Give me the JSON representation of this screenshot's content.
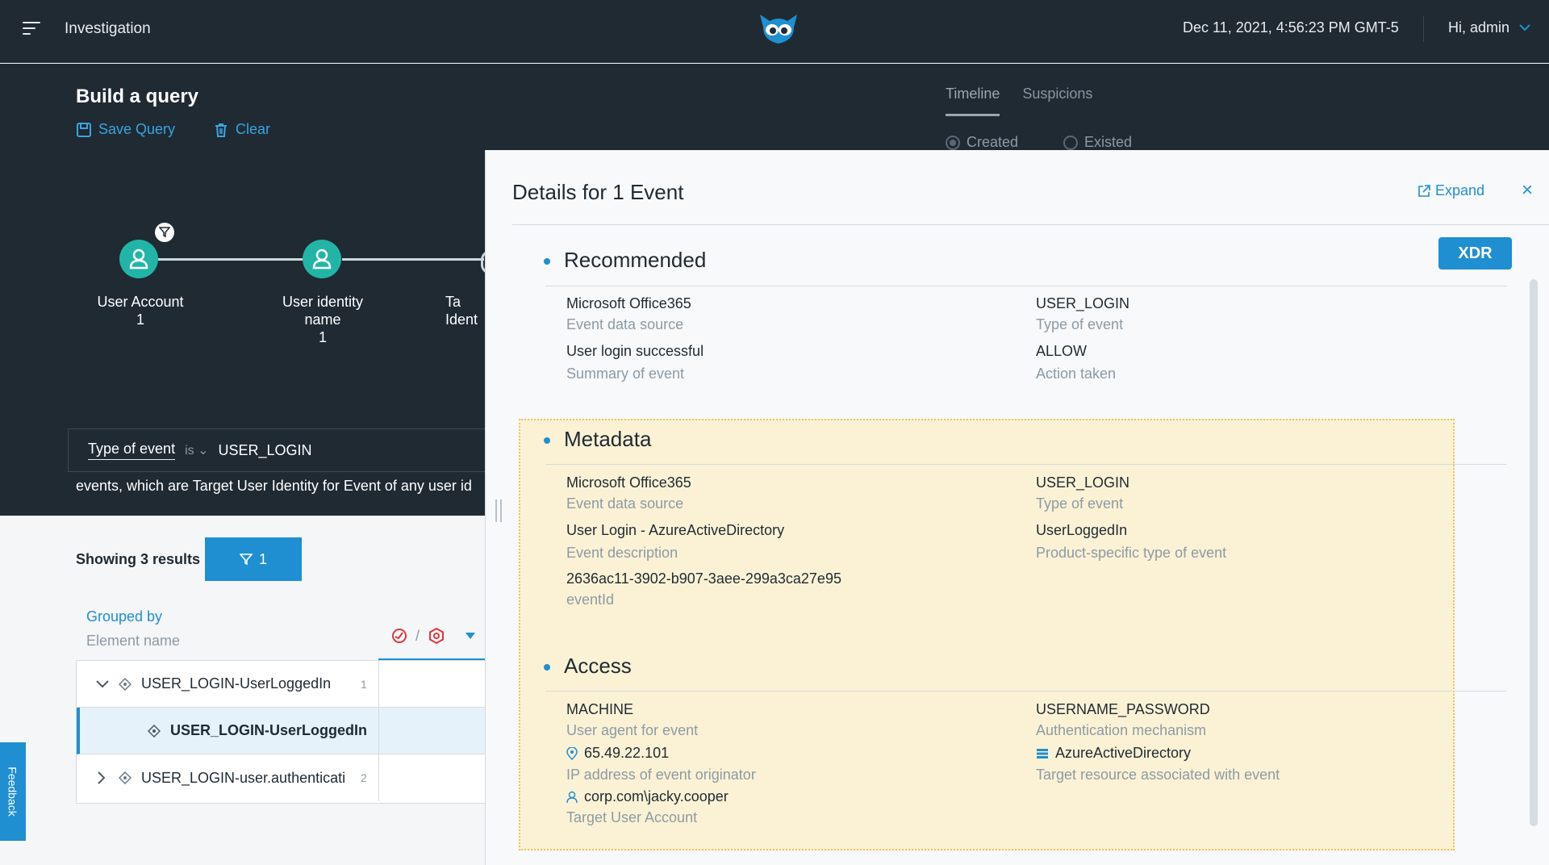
{
  "topbar": {
    "title": "Investigation",
    "datetime": "Dec 11, 2021, 4:56:23 PM GMT-5",
    "user_greeting": "Hi, admin"
  },
  "query": {
    "title": "Build a query",
    "save_label": "Save Query",
    "clear_label": "Clear",
    "tabs": [
      "Timeline",
      "Suspicions"
    ],
    "radios": [
      "Created",
      "Existed"
    ],
    "nodes": [
      {
        "label": "User Account",
        "count": "1"
      },
      {
        "label": "User identity name",
        "count": "1"
      },
      {
        "label": "Ta Ident",
        "count": ""
      }
    ],
    "filter": {
      "key": "Type of event",
      "op": "is",
      "value": "USER_LOGIN"
    },
    "description": "events, which are Target User Identity for Event of any user id"
  },
  "results": {
    "showing": "Showing 3 results",
    "filter_count": "1",
    "grouped_by": "Grouped by",
    "element_name": "Element name",
    "slash": "/",
    "rows": [
      {
        "label": "USER_LOGIN-UserLoggedIn",
        "count": "1"
      },
      {
        "label": "USER_LOGIN-UserLoggedIn",
        "count": ""
      },
      {
        "label": "USER_LOGIN-user.authenticati",
        "count": "2"
      }
    ]
  },
  "feedback_label": "Feedback",
  "details": {
    "title": "Details for 1 Event",
    "expand_label": "Expand",
    "close_label": "×",
    "xdr_label": "XDR",
    "recommended": {
      "title": "Recommended",
      "fields": [
        {
          "value": "Microsoft Office365",
          "label": "Event data source"
        },
        {
          "value": "USER_LOGIN",
          "label": "Type of event"
        },
        {
          "value": "User login successful",
          "label": "Summary of event"
        },
        {
          "value": "ALLOW",
          "label": "Action taken"
        }
      ]
    },
    "metadata": {
      "title": "Metadata",
      "fields": [
        {
          "value": "Microsoft Office365",
          "label": "Event data source"
        },
        {
          "value": "USER_LOGIN",
          "label": "Type of event"
        },
        {
          "value": "User Login - AzureActiveDirectory",
          "label": "Event description"
        },
        {
          "value": "UserLoggedIn",
          "label": "Product-specific type of event"
        },
        {
          "value": "2636ac11-3902-b907-3aee-299a3ca27e95",
          "label": "eventId"
        }
      ]
    },
    "access": {
      "title": "Access",
      "fields": [
        {
          "value": "MACHINE",
          "label": "User agent for event"
        },
        {
          "value": "USERNAME_PASSWORD",
          "label": "Authentication mechanism"
        },
        {
          "value": "65.49.22.101",
          "label": "IP address of event originator"
        },
        {
          "value": "AzureActiveDirectory",
          "label": "Target resource associated with event"
        },
        {
          "value": "corp.com\\jacky.cooper",
          "label": "Target User Account"
        }
      ]
    }
  },
  "colors": {
    "dark_bg": "#1f2a33",
    "accent_blue": "#1f8fd1",
    "node_teal": "#22b5a7",
    "highlight": "#fbf2d5"
  }
}
